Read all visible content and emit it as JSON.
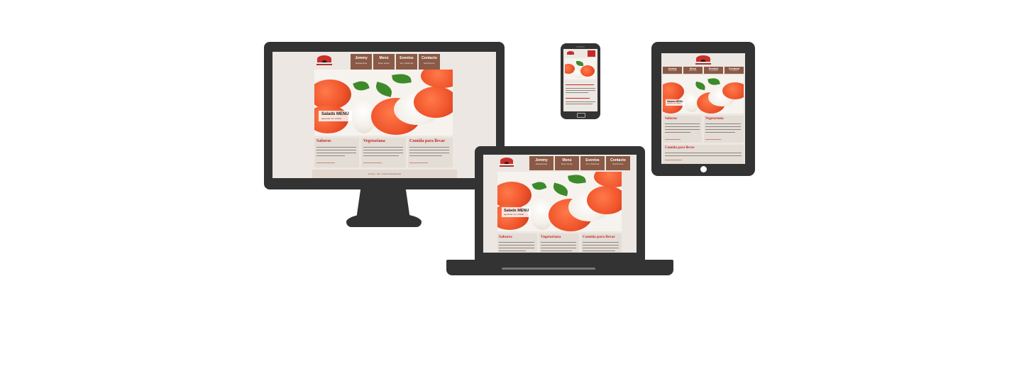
{
  "brand": {
    "accent": "#c62828",
    "nav_bg": "#8a5a47",
    "device_color": "#333333",
    "page_bg": "#ece7e2"
  },
  "nav": [
    {
      "label": "Jommy",
      "sub": "Restaurante"
    },
    {
      "label": "Menú",
      "sub": "Buen Gusto"
    },
    {
      "label": "Eventos",
      "sub": "Ver y Disfrutar"
    },
    {
      "label": "Contacto",
      "sub": "Escríbenos"
    }
  ],
  "hero": {
    "title": "Salads MENU",
    "tagline": "aguacate con crisitán"
  },
  "columns": [
    {
      "title": "Saboros"
    },
    {
      "title": "Vegetariana"
    },
    {
      "title": "Comida para llevar"
    }
  ],
  "footer": "Jommy - Tex • Cocina Restaurante",
  "icons": {
    "logo": "restaurant-logo-icon",
    "home_button": "home-button-icon",
    "speaker": "speaker-icon"
  }
}
